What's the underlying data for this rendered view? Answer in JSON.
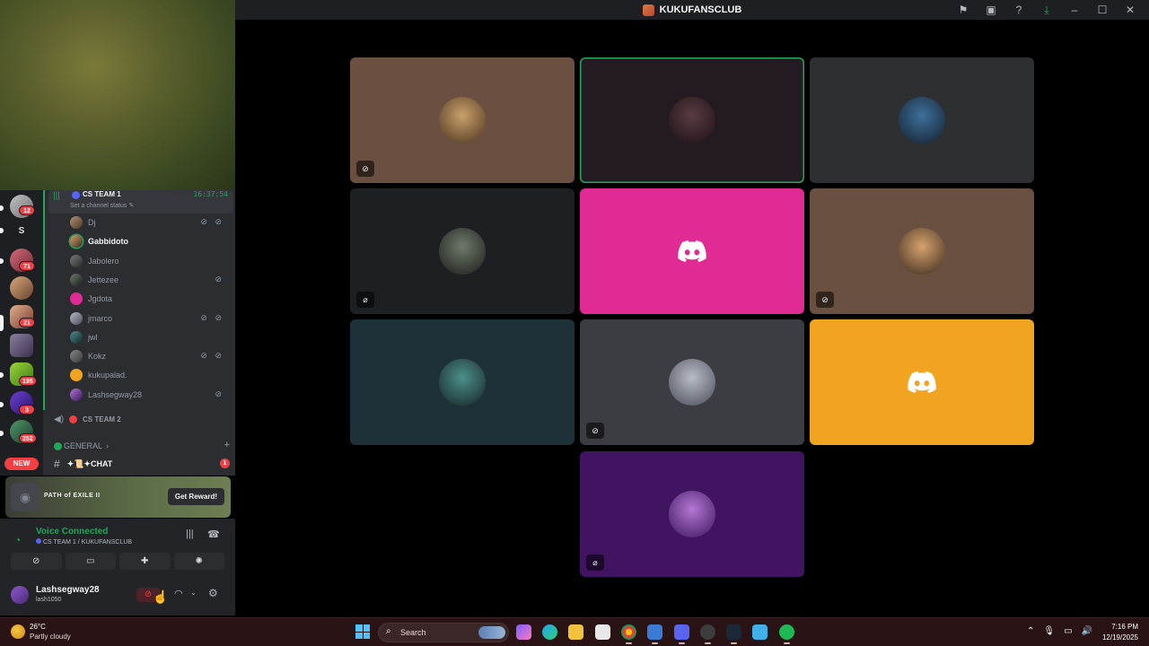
{
  "window": {
    "title": "KUKUFANSCLUB"
  },
  "guilds": [
    {
      "badge": "12"
    },
    {
      "letter": "S"
    },
    {
      "badge": "71"
    },
    {
      "badge": ""
    },
    {
      "badge": "21"
    },
    {
      "badge": ""
    },
    {
      "badge": "195"
    },
    {
      "badge": "3"
    },
    {
      "badge": "252"
    }
  ],
  "new_label": "NEW",
  "voice_channel": {
    "name": "CS TEAM 1",
    "timer": "16:37:54",
    "status_placeholder": "Set a channel status ✎",
    "members": [
      {
        "name": "Dj",
        "icons": "⊘ ⊘"
      },
      {
        "name": "Gabbidoto",
        "icons": "",
        "active": true
      },
      {
        "name": "Jabolero",
        "icons": ""
      },
      {
        "name": "Jettezee",
        "icons": "⊘"
      },
      {
        "name": "Jgdota",
        "icons": ""
      },
      {
        "name": "jmarco",
        "icons": "⊘ ⊘"
      },
      {
        "name": "jwl",
        "icons": ""
      },
      {
        "name": "Kokz",
        "icons": "⊘ ⊘"
      },
      {
        "name": "kukupalad.",
        "icons": ""
      },
      {
        "name": "Lashsegway28",
        "icons": "⊘"
      }
    ]
  },
  "voice_channel_2": {
    "name": "CS TEAM 2"
  },
  "category": {
    "name": "GENERAL",
    "chevron": "›",
    "plus": "+"
  },
  "text_channel": {
    "name": "✦📜✦CHAT",
    "unread": "1"
  },
  "promo": {
    "title": "PATH of EXILE II",
    "button": "Get Reward!"
  },
  "voice_panel": {
    "status": "Voice Connected",
    "path": "CS TEAM 1 / KUKUFANSCLUB"
  },
  "user": {
    "display_name": "Lashsegway28",
    "username": "lash1050"
  },
  "tiles": [
    {
      "bg": "#6b5041",
      "avatar": [
        "#c9a06a",
        "#4a3320"
      ],
      "muted": "deaf",
      "speaking": false
    },
    {
      "bg": "#241a21",
      "avatar": [
        "#5a3c44",
        "#1a1014"
      ],
      "muted": "",
      "speaking": true
    },
    {
      "bg": "#2d2f30",
      "avatar": [
        "#3d6f9a",
        "#14212e"
      ],
      "muted": "",
      "speaking": false
    },
    {
      "bg": "#1d2023",
      "avatar": [
        "#6f7a6b",
        "#1a1c1a"
      ],
      "muted": "mic",
      "speaking": false
    },
    {
      "bg": "#e02a94",
      "avatar": null,
      "muted": "",
      "speaking": false
    },
    {
      "bg": "#6a5040",
      "avatar": [
        "#d6a26c",
        "#3a2a1f"
      ],
      "muted": "deaf",
      "speaking": false
    },
    {
      "bg": "#1e3138",
      "avatar": [
        "#4b8f8a",
        "#172427"
      ],
      "muted": "",
      "speaking": false
    },
    {
      "bg": "#3c3d42",
      "avatar": [
        "#b8bcc6",
        "#4a4d5a"
      ],
      "muted": "deaf",
      "speaking": false
    },
    {
      "bg": "#f0a41f",
      "avatar": null,
      "muted": "",
      "speaking": false
    },
    {
      "bg": "#401460",
      "avatar": [
        "#b476d6",
        "#3a165a"
      ],
      "muted": "mic",
      "speaking": false
    }
  ],
  "taskbar": {
    "weather_temp": "26°C",
    "weather_condition": "Partly cloudy",
    "search_label": "Search",
    "time": "7:16 PM",
    "date": "12/19/2025"
  },
  "colors": {
    "accent_green": "#23a55a",
    "danger": "#f23f43",
    "blurple": "#5865f2"
  }
}
